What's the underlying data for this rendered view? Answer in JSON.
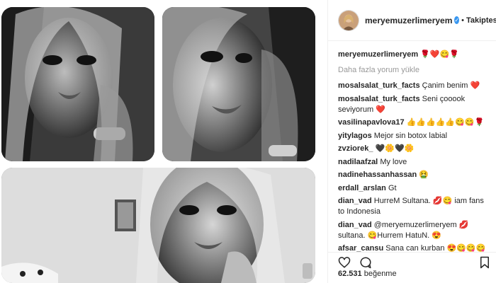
{
  "post": {
    "username": "meryemuzerlimeryem",
    "follow_separator": "•",
    "follow_label": "Takiptesin",
    "verified_icon": "verified-badge-icon",
    "caption_emoji": "🌹❤️😋🌹",
    "load_more": "Daha fazla yorum yükle",
    "likes_count": "62.531",
    "likes_label": "beğenme"
  },
  "comments": [
    {
      "user": "mosalsalat_turk_facts",
      "text": "Çanim benim ❤️"
    },
    {
      "user": "mosalsalat_turk_facts",
      "text": "Seni çooook seviyorum ❤️"
    },
    {
      "user": "vasilinapavlova17",
      "text": "👍👍👍👍👍😋😋🌹"
    },
    {
      "user": "yitylagos",
      "text": "Mejor sin botox labial"
    },
    {
      "user": "zvziorek_",
      "text": "🖤🌼🖤🌼"
    },
    {
      "user": "nadilaafzal",
      "text": "My love"
    },
    {
      "user": "nadinehassanhassan",
      "text": "🤮"
    },
    {
      "user": "erdall_arslan",
      "text": "Gt"
    },
    {
      "user": "dian_vad",
      "text": "HurreM Sultana. 💋😋 iam fans to Indonesia"
    },
    {
      "user": "dian_vad",
      "text": "@meryemuzerlimeryem 💋 sultana. 😋Hurrem HatuN. 😍"
    },
    {
      "user": "afsar_cansu",
      "text": "Sana can kurban 😍😋😋😋"
    }
  ],
  "icons": {
    "like": "heart-icon",
    "comment": "comment-icon",
    "save": "bookmark-icon"
  },
  "colors": {
    "verified": "#3897f0",
    "secondary_text": "#999999",
    "border": "#efefef"
  }
}
